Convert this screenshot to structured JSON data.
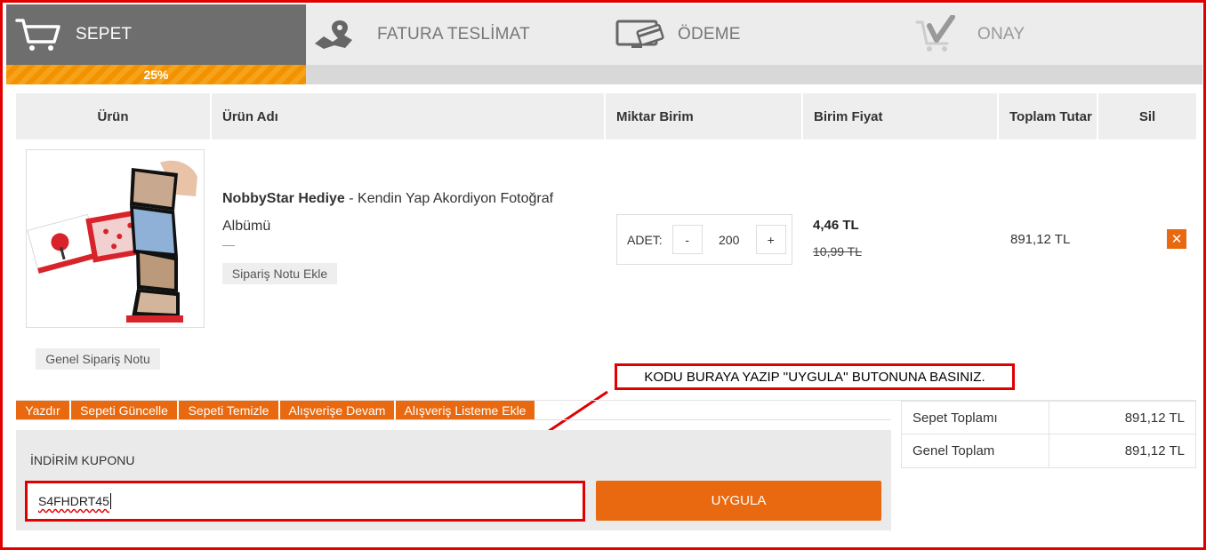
{
  "steps": [
    {
      "label": "SEPET",
      "icon": "shopping-cart-icon",
      "active": true
    },
    {
      "label": "FATURA TESLİMAT",
      "icon": "map-location-icon"
    },
    {
      "label": "ÖDEME",
      "icon": "card-payment-icon"
    },
    {
      "label": "ONAY",
      "icon": "cart-check-icon"
    }
  ],
  "progress": {
    "percent_label": "25%",
    "fraction": 0.25
  },
  "table": {
    "headers": {
      "urun": "Ürün",
      "urun_adi": "Ürün Adı",
      "miktar": "Miktar Birim",
      "birim_fiyat": "Birim Fiyat",
      "toplam": "Toplam Tutar",
      "sil": "Sil"
    }
  },
  "product": {
    "brand": "NobbyStar Hediye",
    "separator": " - ",
    "name": "Kendin Yap Akordiyon Fotoğraf Albümü",
    "note_button": "Sipariş Notu Ekle",
    "qty_label": "ADET:",
    "qty_minus": "-",
    "qty_value": "200",
    "qty_plus": "+",
    "price": "4,46 TL",
    "old_price": "10,99 TL",
    "total": "891,12 TL",
    "delete_symbol": "✕"
  },
  "general_note_button": "Genel Sipariş Notu",
  "annotation": "KODU BURAYA YAZIP ''UYGULA'' BUTONUNA BASINIZ.",
  "actions": [
    "Yazdır",
    "Sepeti Güncelle",
    "Sepeti Temizle",
    "Alışverişe Devam",
    "Alışveriş Listeme Ekle"
  ],
  "coupon": {
    "label": "İNDİRİM KUPONU",
    "value": "S4FHDRT45",
    "apply_label": "UYGULA"
  },
  "totals": [
    {
      "label": "Sepet Toplamı",
      "value": "891,12 TL"
    },
    {
      "label": "Genel Toplam",
      "value": "891,12 TL"
    }
  ],
  "colors": {
    "accent": "#e8690f",
    "progress": "#f39200",
    "highlight": "#e10000",
    "active_step": "#6e6e6e"
  }
}
